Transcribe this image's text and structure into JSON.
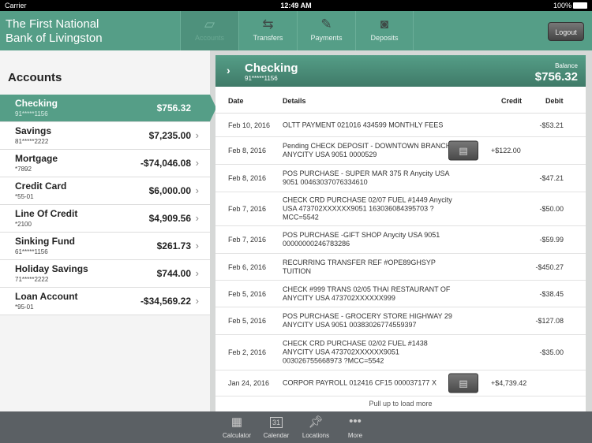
{
  "status_bar": {
    "carrier": "Carrier",
    "time": "12:49 AM",
    "battery": "100%"
  },
  "header": {
    "bank_name": "The First National\nBank of Livingston",
    "tabs": [
      {
        "label": "Accounts",
        "icon": "card-icon",
        "active": true
      },
      {
        "label": "Transfers",
        "icon": "arrows-icon"
      },
      {
        "label": "Payments",
        "icon": "check-pen-icon"
      },
      {
        "label": "Deposits",
        "icon": "camera-icon"
      }
    ],
    "logout": "Logout"
  },
  "sidebar": {
    "title": "Accounts",
    "accounts": [
      {
        "name": "Checking",
        "number": "91*****1156",
        "balance": "$756.32",
        "selected": true
      },
      {
        "name": "Savings",
        "number": "81*****2222",
        "balance": "$7,235.00"
      },
      {
        "name": "Mortgage",
        "number": "*7892",
        "balance": "-$74,046.08"
      },
      {
        "name": "Credit Card",
        "number": "*55-01",
        "balance": "$6,000.00"
      },
      {
        "name": "Line Of Credit",
        "number": "*2100",
        "balance": "$4,909.56"
      },
      {
        "name": "Sinking Fund",
        "number": "61*****1156",
        "balance": "$261.73"
      },
      {
        "name": "Holiday Savings",
        "number": "71*****2222",
        "balance": "$744.00"
      },
      {
        "name": "Loan Account",
        "number": "*95-01",
        "balance": "-$34,569.22"
      }
    ]
  },
  "detail": {
    "title": "Checking",
    "number": "91*****1156",
    "balance_label": "Balance",
    "balance": "$756.32",
    "columns": {
      "date": "Date",
      "details": "Details",
      "credit": "Credit",
      "debit": "Debit"
    },
    "transactions": [
      {
        "date": "Feb 10, 2016",
        "details": "OLTT PAYMENT 021016 434599 MONTHLY FEES",
        "credit": "",
        "debit": "-$53.21"
      },
      {
        "date": "Feb 8, 2016",
        "details": "Pending CHECK DEPOSIT - DOWNTOWN BRANCH ANYCITY USA 9051 0000529",
        "credit": "+$122.00",
        "debit": "",
        "check_image": true
      },
      {
        "date": "Feb 8, 2016",
        "details": "POS PURCHASE -  SUPER MAR 375 R Anycity USA 9051 00463037076334610",
        "credit": "",
        "debit": "-$47.21"
      },
      {
        "date": "Feb 7, 2016",
        "details": "CHECK CRD PURCHASE 02/07  FUEL #1449 Anycity USA 473702XXXXXX9051 163036084395703 ?MCC=5542",
        "credit": "",
        "debit": "-$50.00"
      },
      {
        "date": "Feb 7, 2016",
        "details": "POS PURCHASE -GIFT SHOP Anycity USA 9051 00000000246783286",
        "credit": "",
        "debit": "-$59.99"
      },
      {
        "date": "Feb 6, 2016",
        "details": "RECURRING TRANSFER REF #OPE89GHSYP TUITION",
        "credit": "",
        "debit": "-$450.27"
      },
      {
        "date": "Feb 5, 2016",
        "details": "CHECK #999 TRANS 02/05 THAI RESTAURANT OF ANYCITY USA 473702XXXXXX999",
        "credit": "",
        "debit": "-$38.45"
      },
      {
        "date": "Feb 5, 2016",
        "details": "POS PURCHASE - GROCERY STORE HIGHWAY 29 ANYCITY USA 9051 00383026774559397",
        "credit": "",
        "debit": "-$127.08"
      },
      {
        "date": "Feb 2, 2016",
        "details": "CHECK CRD PURCHASE 02/02 FUEL #1438 ANYCITY USA 473702XXXXXX9051 003026755668973 ?MCC=5542",
        "credit": "",
        "debit": "-$35.00"
      },
      {
        "date": "Jan 24, 2016",
        "details": "CORPOR PAYROLL 012416 CF15 000037177 X",
        "credit": "+$4,739.42",
        "debit": "",
        "check_image": true
      }
    ],
    "load_more": "Pull up to load more"
  },
  "toolbar": {
    "items": [
      {
        "label": "Calculator",
        "icon": "calculator-icon"
      },
      {
        "label": "Calendar",
        "icon": "calendar-icon",
        "day": "31"
      },
      {
        "label": "Locations",
        "icon": "pushpin-icon"
      },
      {
        "label": "More",
        "icon": "more-icon"
      }
    ]
  },
  "colors": {
    "brand": "#559e87",
    "toolbar": "#5b6064"
  }
}
